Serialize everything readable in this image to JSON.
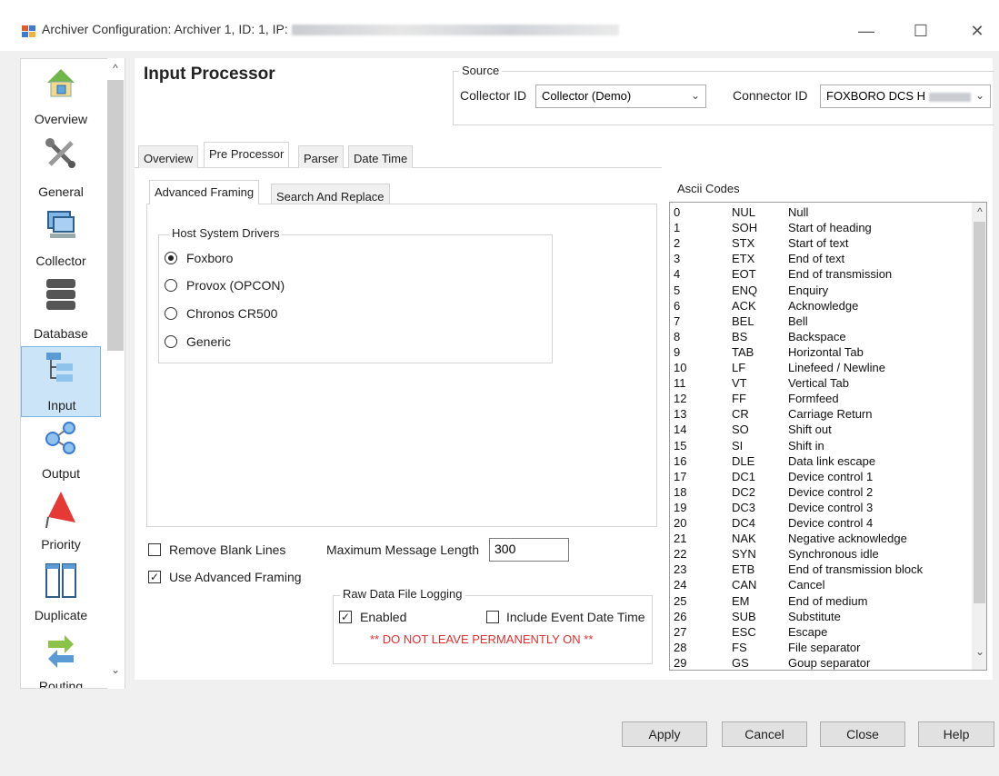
{
  "window": {
    "title": "Archiver Configuration: Archiver 1, ID: 1, IP:",
    "minimize_glyph": "—",
    "maximize_glyph": "☐",
    "close_glyph": "✕"
  },
  "nav": {
    "items": [
      {
        "label": "Overview",
        "icon": "house-icon"
      },
      {
        "label": "General",
        "icon": "tools-icon"
      },
      {
        "label": "Collector",
        "icon": "computer-icon"
      },
      {
        "label": "Database",
        "icon": "database-icon"
      },
      {
        "label": "Input",
        "icon": "hierarchy-icon",
        "selected": true
      },
      {
        "label": "Output",
        "icon": "share-icon"
      },
      {
        "label": "Priority",
        "icon": "flag-icon"
      },
      {
        "label": "Duplicate",
        "icon": "columns-icon"
      },
      {
        "label": "Routing",
        "icon": "arrows-icon"
      }
    ]
  },
  "header": {
    "title": "Input Processor"
  },
  "source": {
    "group_title": "Source",
    "collector_label": "Collector ID",
    "collector_value": "Collector (Demo)",
    "connector_label": "Connector ID",
    "connector_value": "FOXBORO DCS H"
  },
  "tabs": [
    "Overview",
    "Pre Processor",
    "Parser",
    "Date Time"
  ],
  "subtabs": [
    "Advanced Framing",
    "Search And Replace"
  ],
  "host_drivers": {
    "group_title": "Host System Drivers",
    "options": [
      {
        "label": "Foxboro",
        "checked": true
      },
      {
        "label": "Provox (OPCON)",
        "checked": false
      },
      {
        "label": "Chronos CR500",
        "checked": false
      },
      {
        "label": "Generic",
        "checked": false
      }
    ]
  },
  "options": {
    "remove_blank_lines": "Remove Blank Lines",
    "use_advanced_framing": "Use Advanced Framing",
    "max_len_label": "Maximum Message Length",
    "max_len_value": "300",
    "check_mark": "✓"
  },
  "raw_logging": {
    "group_title": "Raw Data File Logging",
    "enabled_label": "Enabled",
    "include_label": "Include Event Date Time",
    "warning": "** DO NOT LEAVE PERMANENTLY ON **"
  },
  "ascii": {
    "group_title": "Ascii Codes",
    "rows": [
      [
        "0",
        "NUL",
        "Null"
      ],
      [
        "1",
        "SOH",
        "Start of heading"
      ],
      [
        "2",
        "STX",
        "Start of text"
      ],
      [
        "3",
        "ETX",
        "End of text"
      ],
      [
        "4",
        "EOT",
        "End of transmission"
      ],
      [
        "5",
        "ENQ",
        "Enquiry"
      ],
      [
        "6",
        "ACK",
        "Acknowledge"
      ],
      [
        "7",
        "BEL",
        "Bell"
      ],
      [
        "8",
        "BS",
        "Backspace"
      ],
      [
        "9",
        "TAB",
        "Horizontal Tab"
      ],
      [
        "10",
        "LF",
        "Linefeed / Newline"
      ],
      [
        "11",
        "VT",
        "Vertical Tab"
      ],
      [
        "12",
        "FF",
        "Formfeed"
      ],
      [
        "13",
        "CR",
        "Carriage Return"
      ],
      [
        "14",
        "SO",
        "Shift out"
      ],
      [
        "15",
        "SI",
        "Shift in"
      ],
      [
        "16",
        "DLE",
        "Data link escape"
      ],
      [
        "17",
        "DC1",
        "Device control 1"
      ],
      [
        "18",
        "DC2",
        "Device control 2"
      ],
      [
        "19",
        "DC3",
        "Device control 3"
      ],
      [
        "20",
        "DC4",
        "Device control 4"
      ],
      [
        "21",
        "NAK",
        "Negative acknowledge"
      ],
      [
        "22",
        "SYN",
        "Synchronous idle"
      ],
      [
        "23",
        "ETB",
        "End of transmission block"
      ],
      [
        "24",
        "CAN",
        "Cancel"
      ],
      [
        "25",
        "EM",
        "End of medium"
      ],
      [
        "26",
        "SUB",
        "Substitute"
      ],
      [
        "27",
        "ESC",
        "Escape"
      ],
      [
        "28",
        "FS",
        "File separator"
      ],
      [
        "29",
        "GS",
        "Goup separator"
      ]
    ]
  },
  "buttons": {
    "apply": "Apply",
    "cancel": "Cancel",
    "close": "Close",
    "help": "Help"
  },
  "glyphs": {
    "up": "^",
    "down": "⌄",
    "combo": "⌄"
  }
}
